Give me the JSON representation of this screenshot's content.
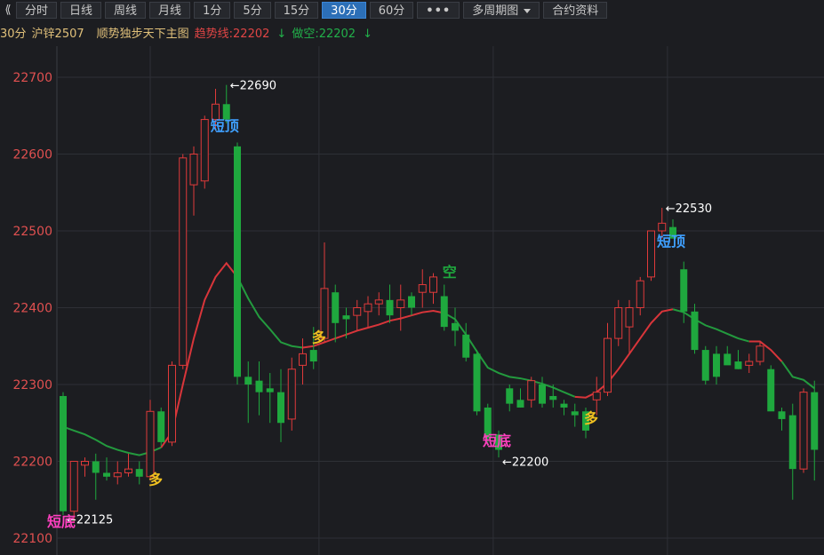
{
  "toolbar": {
    "back_icon": "double-chevron-left-icon",
    "buttons": [
      {
        "label": "分时",
        "active": false
      },
      {
        "label": "日线",
        "active": false
      },
      {
        "label": "周线",
        "active": false
      },
      {
        "label": "月线",
        "active": false
      },
      {
        "label": "1分",
        "active": false
      },
      {
        "label": "5分",
        "active": false
      },
      {
        "label": "15分",
        "active": false
      },
      {
        "label": "30分",
        "active": true
      },
      {
        "label": "60分",
        "active": false
      }
    ],
    "more_label": "•••",
    "multi_period_label": "多周期图",
    "contract_info_label": "合约资料"
  },
  "legend": {
    "period": "30分",
    "symbol": "沪锌2507",
    "study": "顺势独步天下主图",
    "trend_label": "趋势线:22202",
    "trend_arrow": "↓",
    "short_label": "做空:22202",
    "short_arrow": "↓"
  },
  "colors": {
    "background": "#1c1d21",
    "grid": "#2e3036",
    "up": "#e03a3a",
    "down": "#1fa83e",
    "trend_red": "#d8353a",
    "trend_green": "#239a3e",
    "price_label": "#e05050",
    "signal_yellow": "#f0c020",
    "signal_blue": "#3fa0ff",
    "signal_pink": "#ff40c0"
  },
  "chart_data": {
    "type": "candlestick",
    "y_ticks": [
      22100,
      22200,
      22300,
      22400,
      22500,
      22600,
      22700
    ],
    "ylim": [
      22090,
      22750
    ],
    "candles": [
      [
        22285,
        22290,
        22130,
        22135
      ],
      [
        22135,
        22200,
        22120,
        22200
      ],
      [
        22195,
        22205,
        22180,
        22200
      ],
      [
        22200,
        22210,
        22150,
        22185
      ],
      [
        22185,
        22205,
        22175,
        22180
      ],
      [
        22180,
        22200,
        22170,
        22185
      ],
      [
        22185,
        22210,
        22180,
        22190
      ],
      [
        22190,
        22200,
        22170,
        22180
      ],
      [
        22180,
        22280,
        22175,
        22265
      ],
      [
        22265,
        22270,
        22220,
        22225
      ],
      [
        22225,
        22330,
        22220,
        22325
      ],
      [
        22325,
        22600,
        22320,
        22595
      ],
      [
        22560,
        22610,
        22520,
        22600
      ],
      [
        22565,
        22650,
        22555,
        22645
      ],
      [
        22645,
        22685,
        22630,
        22665
      ],
      [
        22665,
        22690,
        22640,
        22645
      ],
      [
        22610,
        22615,
        22300,
        22310
      ],
      [
        22310,
        22330,
        22250,
        22300
      ],
      [
        22305,
        22330,
        22260,
        22290
      ],
      [
        22295,
        22315,
        22250,
        22290
      ],
      [
        22290,
        22320,
        22225,
        22250
      ],
      [
        22255,
        22335,
        22240,
        22320
      ],
      [
        22325,
        22360,
        22300,
        22340
      ],
      [
        22345,
        22375,
        22320,
        22330
      ],
      [
        22360,
        22485,
        22355,
        22425
      ],
      [
        22420,
        22430,
        22355,
        22380
      ],
      [
        22390,
        22400,
        22360,
        22385
      ],
      [
        22390,
        22410,
        22370,
        22400
      ],
      [
        22395,
        22415,
        22375,
        22405
      ],
      [
        22405,
        22420,
        22390,
        22410
      ],
      [
        22410,
        22430,
        22380,
        22390
      ],
      [
        22400,
        22430,
        22370,
        22410
      ],
      [
        22415,
        22420,
        22390,
        22400
      ],
      [
        22420,
        22450,
        22400,
        22430
      ],
      [
        22420,
        22445,
        22405,
        22440
      ],
      [
        22415,
        22430,
        22370,
        22375
      ],
      [
        22380,
        22400,
        22350,
        22370
      ],
      [
        22365,
        22380,
        22330,
        22335
      ],
      [
        22340,
        22345,
        22260,
        22265
      ],
      [
        22270,
        22275,
        22220,
        22230
      ],
      [
        22235,
        22240,
        22205,
        22215
      ],
      [
        22295,
        22300,
        22265,
        22275
      ],
      [
        22280,
        22295,
        22270,
        22270
      ],
      [
        22280,
        22310,
        22270,
        22305
      ],
      [
        22300,
        22310,
        22270,
        22275
      ],
      [
        22285,
        22300,
        22270,
        22280
      ],
      [
        22275,
        22280,
        22260,
        22270
      ],
      [
        22265,
        22275,
        22245,
        22260
      ],
      [
        22265,
        22270,
        22230,
        22240
      ],
      [
        22280,
        22310,
        22260,
        22290
      ],
      [
        22290,
        22380,
        22285,
        22360
      ],
      [
        22360,
        22410,
        22350,
        22400
      ],
      [
        22375,
        22410,
        22340,
        22400
      ],
      [
        22400,
        22440,
        22390,
        22435
      ],
      [
        22440,
        22500,
        22435,
        22500
      ],
      [
        22500,
        22530,
        22490,
        22510
      ],
      [
        22505,
        22515,
        22490,
        22490
      ],
      [
        22450,
        22460,
        22380,
        22395
      ],
      [
        22395,
        22405,
        22340,
        22345
      ],
      [
        22345,
        22350,
        22300,
        22305
      ],
      [
        22340,
        22350,
        22300,
        22310
      ],
      [
        22340,
        22350,
        22330,
        22325
      ],
      [
        22330,
        22345,
        22320,
        22320
      ],
      [
        22325,
        22340,
        22315,
        22330
      ],
      [
        22330,
        22355,
        22325,
        22350
      ],
      [
        22320,
        22325,
        22270,
        22265
      ],
      [
        22265,
        22270,
        22240,
        22255
      ],
      [
        22260,
        22275,
        22150,
        22190
      ],
      [
        22190,
        22295,
        22185,
        22290
      ],
      [
        22290,
        22305,
        22175,
        22215
      ]
    ],
    "trend_line": [
      [
        0,
        22245
      ],
      [
        1,
        22240
      ],
      [
        2,
        22235
      ],
      [
        3,
        22228
      ],
      [
        4,
        22220
      ],
      [
        5,
        22215
      ],
      [
        6,
        22211
      ],
      [
        7,
        22208
      ],
      [
        8,
        22212
      ],
      [
        9,
        22218
      ],
      [
        10,
        22238
      ],
      [
        11,
        22300
      ],
      [
        12,
        22360
      ],
      [
        13,
        22410
      ],
      [
        14,
        22440
      ],
      [
        15,
        22458
      ],
      [
        16,
        22440
      ],
      [
        17,
        22412
      ],
      [
        18,
        22388
      ],
      [
        19,
        22372
      ],
      [
        20,
        22355
      ],
      [
        21,
        22350
      ],
      [
        22,
        22348
      ],
      [
        23,
        22350
      ],
      [
        24,
        22355
      ],
      [
        25,
        22360
      ],
      [
        26,
        22365
      ],
      [
        27,
        22370
      ],
      [
        28,
        22374
      ],
      [
        29,
        22378
      ],
      [
        30,
        22383
      ],
      [
        31,
        22386
      ],
      [
        32,
        22390
      ],
      [
        33,
        22394
      ],
      [
        34,
        22396
      ],
      [
        35,
        22393
      ],
      [
        36,
        22385
      ],
      [
        37,
        22365
      ],
      [
        38,
        22343
      ],
      [
        39,
        22322
      ],
      [
        40,
        22315
      ],
      [
        41,
        22310
      ],
      [
        42,
        22308
      ],
      [
        43,
        22305
      ],
      [
        44,
        22301
      ],
      [
        45,
        22296
      ],
      [
        46,
        22290
      ],
      [
        47,
        22284
      ],
      [
        48,
        22283
      ],
      [
        49,
        22290
      ],
      [
        50,
        22302
      ],
      [
        51,
        22320
      ],
      [
        52,
        22340
      ],
      [
        53,
        22360
      ],
      [
        54,
        22380
      ],
      [
        55,
        22395
      ],
      [
        56,
        22398
      ],
      [
        57,
        22394
      ],
      [
        58,
        22385
      ],
      [
        59,
        22377
      ],
      [
        60,
        22372
      ],
      [
        61,
        22366
      ],
      [
        62,
        22360
      ],
      [
        63,
        22356
      ],
      [
        64,
        22356
      ],
      [
        65,
        22345
      ],
      [
        66,
        22330
      ],
      [
        67,
        22310
      ],
      [
        68,
        22306
      ],
      [
        69,
        22295
      ]
    ],
    "trend_segments": [
      {
        "color": "#239a3e",
        "from": 0,
        "to": 9
      },
      {
        "color": "#d8353a",
        "from": 9,
        "to": 16
      },
      {
        "color": "#239a3e",
        "from": 16,
        "to": 22
      },
      {
        "color": "#d8353a",
        "from": 22,
        "to": 35
      },
      {
        "color": "#239a3e",
        "from": 35,
        "to": 47
      },
      {
        "color": "#d8353a",
        "from": 47,
        "to": 56
      },
      {
        "color": "#239a3e",
        "from": 56,
        "to": 63
      },
      {
        "color": "#d8353a",
        "from": 63,
        "to": 66
      },
      {
        "color": "#239a3e",
        "from": 66,
        "to": 69
      }
    ],
    "price_annotations": [
      {
        "index": 0,
        "value": 22125,
        "text": "←22125"
      },
      {
        "index": 15,
        "value": 22690,
        "text": "←22690"
      },
      {
        "index": 40,
        "value": 22200,
        "text": "←22200"
      },
      {
        "index": 55,
        "value": 22530,
        "text": "←22530"
      }
    ],
    "signals": [
      {
        "index": 0,
        "value": 22115,
        "text": "短底",
        "color": "signal_pink"
      },
      {
        "index": 8,
        "value": 22170,
        "text": "多",
        "color": "signal_yellow"
      },
      {
        "index": 15,
        "value": 22630,
        "text": "短顶",
        "color": "signal_blue"
      },
      {
        "index": 23,
        "value": 22355,
        "text": "多",
        "color": "signal_yellow"
      },
      {
        "index": 35,
        "value": 22440,
        "text": "空",
        "color": "down"
      },
      {
        "index": 40,
        "value": 22220,
        "text": "短底",
        "color": "signal_pink"
      },
      {
        "index": 48,
        "value": 22250,
        "text": "多",
        "color": "signal_yellow"
      },
      {
        "index": 56,
        "value": 22480,
        "text": "短顶",
        "color": "signal_blue"
      }
    ]
  }
}
